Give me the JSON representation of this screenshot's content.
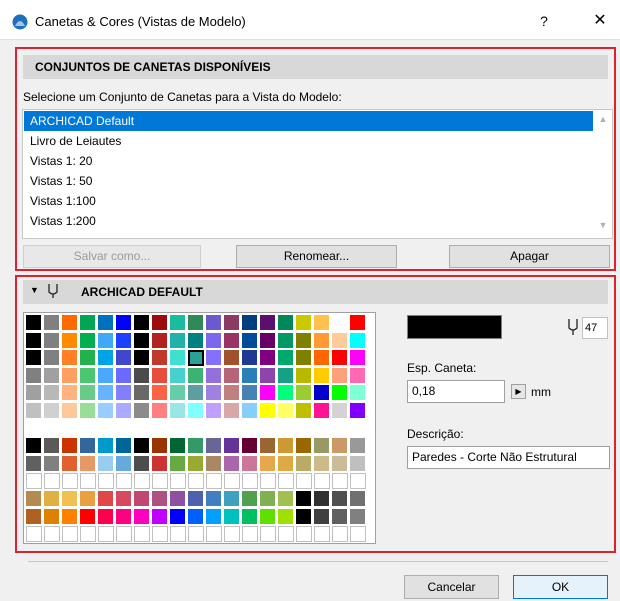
{
  "window": {
    "title": "Canetas & Cores (Vistas de Modelo)",
    "help_label": "?",
    "close_label": "✕"
  },
  "pensets": {
    "header": "CONJUNTOS DE CANETAS DISPONÍVEIS",
    "instruction": "Selecione um Conjunto de Canetas para a Vista do Modelo:",
    "items": [
      {
        "label": "ARCHICAD Default",
        "selected": true
      },
      {
        "label": "Livro de Leiautes",
        "selected": false
      },
      {
        "label": "Vistas 1: 20",
        "selected": false
      },
      {
        "label": "Vistas 1: 50",
        "selected": false
      },
      {
        "label": "Vistas 1:100",
        "selected": false
      },
      {
        "label": "Vistas 1:200",
        "selected": false
      }
    ],
    "save_as_label": "Salvar como...",
    "rename_label": "Renomear...",
    "delete_label": "Apagar"
  },
  "penset_detail": {
    "header": "ARCHICAD DEFAULT",
    "selected_pen_color": "#000000",
    "pen_number": "47",
    "weight_label": "Esp. Caneta:",
    "weight_value": "0,18",
    "weight_unit": "mm",
    "description_label": "Descrição:",
    "description_value": "Paredes - Corte Não Estrutural"
  },
  "palette": {
    "selected_cell": 47,
    "rows": [
      [
        "#000000",
        "#808080",
        "#ff6a00",
        "#00a651",
        "#0072bc",
        "#0000ff",
        "#000000",
        "#9e0b0f",
        "#1abc9c",
        "#2e8b57",
        "#6a5acd",
        "#8b3a62",
        "#003f7f",
        "#5b0f6e",
        "#00875a",
        "#c9c900",
        "#ffc04d",
        "#ffffff",
        "#ff0000"
      ],
      [
        "#000000",
        "#808080",
        "#ff8c00",
        "#00b050",
        "#3fa9f5",
        "#1e40ff",
        "#000000",
        "#b22222",
        "#20b2aa",
        "#008080",
        "#7b68ee",
        "#993366",
        "#004c99",
        "#660066",
        "#009966",
        "#7f7f00",
        "#ff9933",
        "#ffcc99",
        "#00ffff"
      ],
      [
        "#000000",
        "#808080",
        "#ff7f27",
        "#22b14c",
        "#00a2e8",
        "#3f48cc",
        "#000000",
        "#c0392b",
        "#40e0d0",
        "#2aa198",
        "#8470ff",
        "#a0522d",
        "#1f3a93",
        "#800080",
        "#00a86b",
        "#808000",
        "#ff6600",
        "#ff0000",
        "#ff00ff"
      ],
      [
        "#808080",
        "#a0a0a0",
        "#ff9f60",
        "#4cc76f",
        "#4aa8ff",
        "#6a6aff",
        "#4b4b4b",
        "#e74c3c",
        "#48d1cc",
        "#3cb371",
        "#9370db",
        "#b56576",
        "#2980b9",
        "#8e44ad",
        "#16a085",
        "#b8b800",
        "#ffcc00",
        "#ffa07a",
        "#ff69b4"
      ],
      [
        "#a0a0a0",
        "#b8b8b8",
        "#ffb380",
        "#66cc88",
        "#66b3ff",
        "#7f7fff",
        "#696969",
        "#ff6347",
        "#66cdaa",
        "#5f9ea0",
        "#a080e0",
        "#c08080",
        "#4682b4",
        "#ff00ff",
        "#00ff7f",
        "#9acd32",
        "#0000cd",
        "#00ff00",
        "#7fffd4"
      ],
      [
        "#c0c0c0",
        "#d0d0d0",
        "#ffc899",
        "#99dd99",
        "#99ccff",
        "#aaaaff",
        "#8b8b8b",
        "#ff8080",
        "#99e6e6",
        "#80ffff",
        "#c0a0ff",
        "#d8a8a8",
        "#87cefa",
        "#ffff00",
        "#ffff66",
        "#bfbf00",
        "#ff1493",
        "#d3d3d3",
        "#8000ff"
      ],
      [
        "#ffffff",
        "#ffffff",
        "#ffffff",
        "#ffffff",
        "#ffffff",
        "#ffffff",
        "#ffffff",
        "#ffffff",
        "#ffffff",
        "#ffffff",
        "#ffffff",
        "#ffffff",
        "#ffffff",
        "#ffffff",
        "#ffffff",
        "#ffffff",
        "#ffffff",
        "#ffffff",
        "#ffffff"
      ],
      [
        "#000000",
        "#5a5a5a",
        "#cc3300",
        "#336699",
        "#0099cc",
        "#006699",
        "#000000",
        "#993300",
        "#006633",
        "#339966",
        "#666699",
        "#663399",
        "#660033",
        "#996633",
        "#cc9933",
        "#996600",
        "#999966",
        "#cc9966",
        "#999999"
      ],
      [
        "#606060",
        "#808080",
        "#e06030",
        "#e69966",
        "#99ccee",
        "#66aadd",
        "#4d4d4d",
        "#cc3333",
        "#66aa44",
        "#99aa33",
        "#aa8866",
        "#aa66aa",
        "#cc7799",
        "#e6a84d",
        "#ddaa44",
        "#bbaa66",
        "#ccbb88",
        "#ccbb99",
        "#bfbfbf"
      ],
      [
        null,
        null,
        null,
        null,
        null,
        null,
        null,
        null,
        null,
        null,
        null,
        null,
        null,
        null,
        null,
        null,
        null,
        null,
        null
      ],
      [
        "#b58a50",
        "#e0b040",
        "#f0c050",
        "#e8a040",
        "#e04848",
        "#d84860",
        "#c04870",
        "#b05080",
        "#9050a0",
        "#5060b0",
        "#4080c0",
        "#40a0c0",
        "#50a050",
        "#80b050",
        "#a0c050",
        "#000000",
        "#303030",
        "#505050",
        "#707070"
      ],
      [
        "#b06020",
        "#e08000",
        "#ff8000",
        "#ff0000",
        "#ff0050",
        "#ff0080",
        "#ff00c0",
        "#c000ff",
        "#0000ff",
        "#0060ff",
        "#00a0ff",
        "#00c0c0",
        "#00c060",
        "#60e000",
        "#a0e000",
        "#000000",
        "#404040",
        "#606060",
        "#808080"
      ],
      [
        null,
        null,
        null,
        null,
        null,
        null,
        null,
        null,
        null,
        null,
        null,
        null,
        null,
        null,
        null,
        null,
        null,
        null,
        null
      ]
    ]
  }
}
